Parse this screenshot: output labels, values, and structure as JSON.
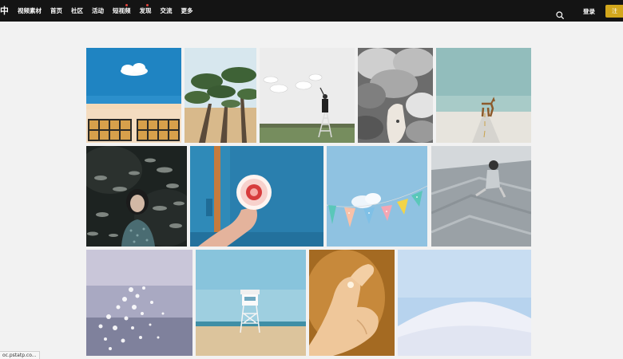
{
  "header": {
    "logo_text": "中",
    "nav": [
      {
        "label": "视频素材",
        "badge": false
      },
      {
        "label": "首页",
        "badge": false
      },
      {
        "label": "社区",
        "badge": false
      },
      {
        "label": "活动",
        "badge": false
      },
      {
        "label": "短视频",
        "badge": true
      },
      {
        "label": "发现",
        "badge": true
      },
      {
        "label": "交流",
        "badge": false
      },
      {
        "label": "更多",
        "badge": false
      }
    ],
    "search_icon": "search-icon",
    "login_label": "登录",
    "register_label": "注"
  },
  "gallery": {
    "photos": [
      {
        "subject": "cloud-over-building"
      },
      {
        "subject": "pine-trees"
      },
      {
        "subject": "girl-on-ladder-with-clouds"
      },
      {
        "subject": "white-horse-in-smoke"
      },
      {
        "subject": "horse-on-road"
      },
      {
        "subject": "girl-with-fish"
      },
      {
        "subject": "hand-holding-cake"
      },
      {
        "subject": "bunting-flags"
      },
      {
        "subject": "girl-on-concrete-steps"
      },
      {
        "subject": "sparkling-water"
      },
      {
        "subject": "lifeguard-tower"
      },
      {
        "subject": "hand-with-light"
      },
      {
        "subject": "white-dune"
      }
    ]
  },
  "status_bar": {
    "text": "oc.pstatp.co..."
  },
  "colors": {
    "nav_bg": "#141414",
    "accent": "#d3a71c",
    "page_bg": "#f2f2f2"
  }
}
